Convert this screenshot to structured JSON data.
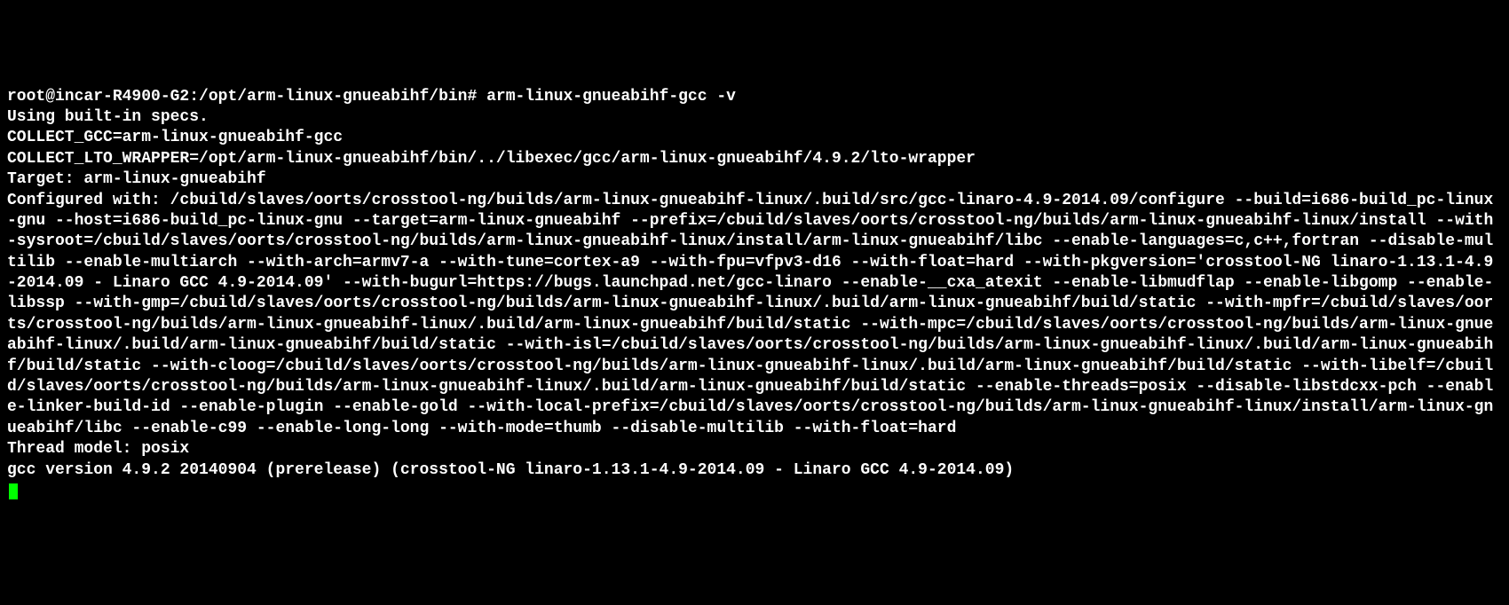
{
  "terminal": {
    "prompt_line": "root@incar-R4900-G2:/opt/arm-linux-gnueabihf/bin# arm-linux-gnueabihf-gcc -v",
    "line2": "Using built-in specs.",
    "line3": "COLLECT_GCC=arm-linux-gnueabihf-gcc",
    "line4": "COLLECT_LTO_WRAPPER=/opt/arm-linux-gnueabihf/bin/../libexec/gcc/arm-linux-gnueabihf/4.9.2/lto-wrapper",
    "line5": "Target: arm-linux-gnueabihf",
    "line6": "Configured with: /cbuild/slaves/oorts/crosstool-ng/builds/arm-linux-gnueabihf-linux/.build/src/gcc-linaro-4.9-2014.09/configure --build=i686-build_pc-linux-gnu --host=i686-build_pc-linux-gnu --target=arm-linux-gnueabihf --prefix=/cbuild/slaves/oorts/crosstool-ng/builds/arm-linux-gnueabihf-linux/install --with-sysroot=/cbuild/slaves/oorts/crosstool-ng/builds/arm-linux-gnueabihf-linux/install/arm-linux-gnueabihf/libc --enable-languages=c,c++,fortran --disable-multilib --enable-multiarch --with-arch=armv7-a --with-tune=cortex-a9 --with-fpu=vfpv3-d16 --with-float=hard --with-pkgversion='crosstool-NG linaro-1.13.1-4.9-2014.09 - Linaro GCC 4.9-2014.09' --with-bugurl=https://bugs.launchpad.net/gcc-linaro --enable-__cxa_atexit --enable-libmudflap --enable-libgomp --enable-libssp --with-gmp=/cbuild/slaves/oorts/crosstool-ng/builds/arm-linux-gnueabihf-linux/.build/arm-linux-gnueabihf/build/static --with-mpfr=/cbuild/slaves/oorts/crosstool-ng/builds/arm-linux-gnueabihf-linux/.build/arm-linux-gnueabihf/build/static --with-mpc=/cbuild/slaves/oorts/crosstool-ng/builds/arm-linux-gnueabihf-linux/.build/arm-linux-gnueabihf/build/static --with-isl=/cbuild/slaves/oorts/crosstool-ng/builds/arm-linux-gnueabihf-linux/.build/arm-linux-gnueabihf/build/static --with-cloog=/cbuild/slaves/oorts/crosstool-ng/builds/arm-linux-gnueabihf-linux/.build/arm-linux-gnueabihf/build/static --with-libelf=/cbuild/slaves/oorts/crosstool-ng/builds/arm-linux-gnueabihf-linux/.build/arm-linux-gnueabihf/build/static --enable-threads=posix --disable-libstdcxx-pch --enable-linker-build-id --enable-plugin --enable-gold --with-local-prefix=/cbuild/slaves/oorts/crosstool-ng/builds/arm-linux-gnueabihf-linux/install/arm-linux-gnueabihf/libc --enable-c99 --enable-long-long --with-mode=thumb --disable-multilib --with-float=hard",
    "line7": "Thread model: posix",
    "line8": "gcc version 4.9.2 20140904 (prerelease) (crosstool-NG linaro-1.13.1-4.9-2014.09 - Linaro GCC 4.9-2014.09)"
  }
}
